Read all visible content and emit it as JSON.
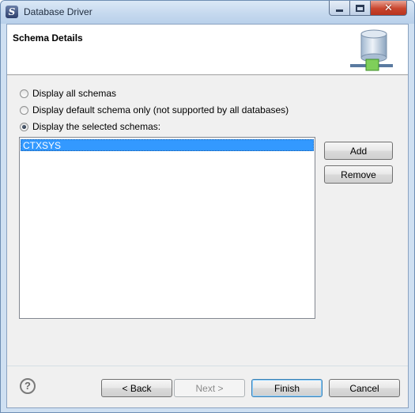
{
  "window": {
    "title": "Database Driver",
    "app_icon": "S-logo"
  },
  "header": {
    "title": "Schema Details",
    "icon": "database-network-icon"
  },
  "options": [
    {
      "label": "Display all schemas",
      "selected": false
    },
    {
      "label": "Display default schema only (not supported by all databases)",
      "selected": false
    },
    {
      "label": "Display the selected schemas:",
      "selected": true
    }
  ],
  "schemas": {
    "items": [
      "CTXSYS"
    ],
    "selected_index": 0
  },
  "side_buttons": {
    "add": "Add",
    "remove": "Remove"
  },
  "footer": {
    "back": "< Back",
    "next": "Next >",
    "finish": "Finish",
    "cancel": "Cancel",
    "help_icon": "?"
  }
}
